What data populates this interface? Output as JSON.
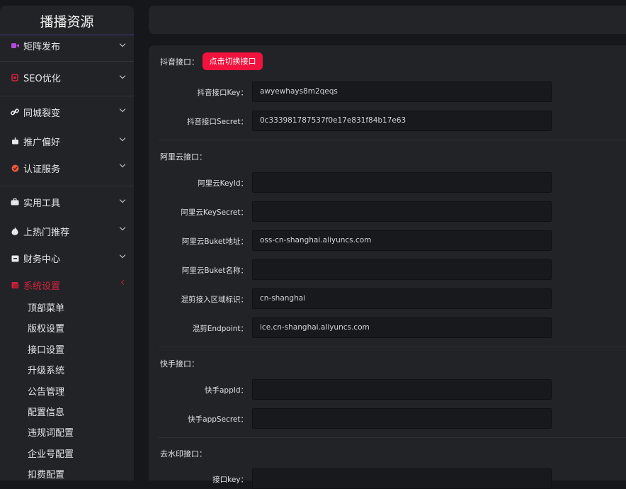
{
  "sidebar": {
    "brand": "播播资源",
    "menu": [
      {
        "label": "矩阵发布",
        "icon": "video-icon",
        "color": "#b24ad9"
      },
      {
        "label": "SEO优化",
        "icon": "seo-icon",
        "color": "#d0243f"
      },
      {
        "label": "同城裂变",
        "icon": "link-icon",
        "color": "#e8e8ea"
      },
      {
        "label": "推广偏好",
        "icon": "robot-icon",
        "color": "#e8e8ea"
      },
      {
        "label": "认证服务",
        "icon": "badge-icon",
        "color": "#f0563a"
      },
      {
        "label": "实用工具",
        "icon": "toolbox-icon",
        "color": "#e8e8ea"
      },
      {
        "label": "上热门推荐",
        "icon": "fire-icon",
        "color": "#e8e8ea"
      },
      {
        "label": "财务中心",
        "icon": "wallet-icon",
        "color": "#e8e8ea"
      },
      {
        "label": "系统设置",
        "icon": "settings-icon",
        "color": "#d0243f"
      }
    ],
    "submenu": [
      "顶部菜单",
      "版权设置",
      "接口设置",
      "升级系统",
      "公告管理",
      "配置信息",
      "违规词配置",
      "企业号配置",
      "扣费配置"
    ]
  },
  "form": {
    "douyin": {
      "title": "抖音接口：",
      "switch_button": "点击切换接口",
      "key_label": "抖音接口Key：",
      "key_value": "awyewhays8m2qeqs",
      "secret_label": "抖音接口Secret：",
      "secret_value": "0c333981787537f0e17e831f84b17e63"
    },
    "aliyun": {
      "title": "阿里云接口：",
      "keyid_label": "阿里云KeyId：",
      "keyid_value": "",
      "keysecret_label": "阿里云KeySecret：",
      "keysecret_value": "",
      "buket_addr_label": "阿里云Buket地址：",
      "buket_addr_value": "oss-cn-shanghai.aliyuncs.com",
      "buket_name_label": "阿里云Buket名称：",
      "buket_name_value": "",
      "region_label": "混剪接入区域标识：",
      "region_value": "cn-shanghai",
      "endpoint_label": "混剪Endpoint：",
      "endpoint_value": "ice.cn-shanghai.aliyuncs.com"
    },
    "kuaishou": {
      "title": "快手接口：",
      "appid_label": "快手appId：",
      "appid_value": "",
      "appsecret_label": "快手appSecret：",
      "appsecret_value": ""
    },
    "watermark": {
      "title": "去水印接口：",
      "key_label": "接口key：",
      "key_value": ""
    }
  }
}
